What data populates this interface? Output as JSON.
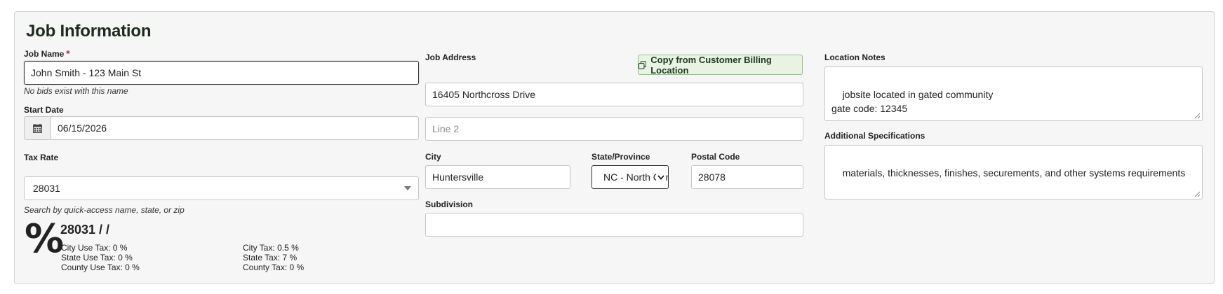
{
  "section_title": "Job Information",
  "job_name": {
    "label": "Job Name",
    "required_mark": "*",
    "value": "John Smith - 123 Main St",
    "hint": "No bids exist with this name"
  },
  "start_date": {
    "label": "Start Date",
    "value": "06/15/2026"
  },
  "tax_rate": {
    "label": "Tax Rate",
    "value": "28031",
    "hint": "Search by quick-access name, state, or zip",
    "summary": {
      "symbol": "%",
      "heading": "28031 / /",
      "city_use_tax": "City Use Tax: 0 %",
      "state_use_tax": "State Use Tax: 0 %",
      "county_use_tax": "County Use Tax: 0 %",
      "city_tax": "City Tax: 0.5 %",
      "state_tax": "State Tax: 7 %",
      "county_tax": "County Tax: 0 %"
    }
  },
  "job_address": {
    "label": "Job Address",
    "copy_button": "Copy from Customer Billing Location",
    "line1": "16405 Northcross Drive",
    "line2_placeholder": "Line 2",
    "city_label": "City",
    "city_value": "Huntersville",
    "state_label": "State/Province",
    "state_value": "NC - North Carolina",
    "postal_label": "Postal Code",
    "postal_value": "28078",
    "subdivision_label": "Subdivision",
    "subdivision_value": ""
  },
  "location_notes": {
    "label": "Location Notes",
    "value": "jobsite located in gated community\ngate code: 12345"
  },
  "additional_specs": {
    "label": "Additional Specifications",
    "value": "materials, thicknesses, finishes, securements, and other systems requirements"
  },
  "colors": {
    "required": "#a21a2b",
    "button_bg": "#e8f3e4",
    "button_border": "#8fbf86"
  },
  "icons": {
    "calendar": "calendar-icon",
    "copy": "copy-icon",
    "caret": "caret-down-icon",
    "percent": "percent-icon"
  }
}
